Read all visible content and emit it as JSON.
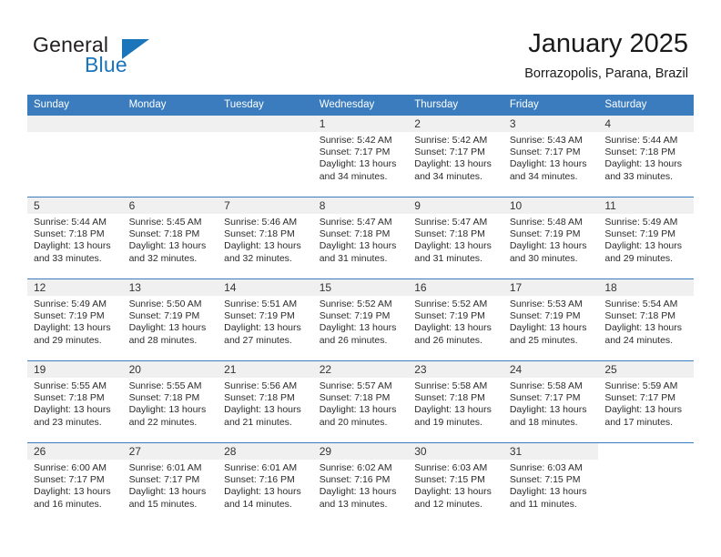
{
  "brand": {
    "word_general": "General",
    "word_blue": "Blue",
    "accent_color": "#1b75bb"
  },
  "header": {
    "title": "January 2025",
    "subtitle": "Borrazopolis, Parana, Brazil",
    "header_bg": "#3a7cbe",
    "daynum_bg": "#f0f0f0"
  },
  "weekdays": [
    "Sunday",
    "Monday",
    "Tuesday",
    "Wednesday",
    "Thursday",
    "Friday",
    "Saturday"
  ],
  "labels": {
    "sunrise_prefix": "Sunrise:",
    "sunset_prefix": "Sunset:",
    "daylight_prefix": "Daylight:"
  },
  "weeks": [
    [
      {
        "day": "",
        "empty": true
      },
      {
        "day": "",
        "empty": true
      },
      {
        "day": "",
        "empty": true
      },
      {
        "day": "1",
        "sunrise": "Sunrise: 5:42 AM",
        "sunset": "Sunset: 7:17 PM",
        "daylight_1": "Daylight: 13 hours",
        "daylight_2": "and 34 minutes."
      },
      {
        "day": "2",
        "sunrise": "Sunrise: 5:42 AM",
        "sunset": "Sunset: 7:17 PM",
        "daylight_1": "Daylight: 13 hours",
        "daylight_2": "and 34 minutes."
      },
      {
        "day": "3",
        "sunrise": "Sunrise: 5:43 AM",
        "sunset": "Sunset: 7:17 PM",
        "daylight_1": "Daylight: 13 hours",
        "daylight_2": "and 34 minutes."
      },
      {
        "day": "4",
        "sunrise": "Sunrise: 5:44 AM",
        "sunset": "Sunset: 7:18 PM",
        "daylight_1": "Daylight: 13 hours",
        "daylight_2": "and 33 minutes."
      }
    ],
    [
      {
        "day": "5",
        "sunrise": "Sunrise: 5:44 AM",
        "sunset": "Sunset: 7:18 PM",
        "daylight_1": "Daylight: 13 hours",
        "daylight_2": "and 33 minutes."
      },
      {
        "day": "6",
        "sunrise": "Sunrise: 5:45 AM",
        "sunset": "Sunset: 7:18 PM",
        "daylight_1": "Daylight: 13 hours",
        "daylight_2": "and 32 minutes."
      },
      {
        "day": "7",
        "sunrise": "Sunrise: 5:46 AM",
        "sunset": "Sunset: 7:18 PM",
        "daylight_1": "Daylight: 13 hours",
        "daylight_2": "and 32 minutes."
      },
      {
        "day": "8",
        "sunrise": "Sunrise: 5:47 AM",
        "sunset": "Sunset: 7:18 PM",
        "daylight_1": "Daylight: 13 hours",
        "daylight_2": "and 31 minutes."
      },
      {
        "day": "9",
        "sunrise": "Sunrise: 5:47 AM",
        "sunset": "Sunset: 7:18 PM",
        "daylight_1": "Daylight: 13 hours",
        "daylight_2": "and 31 minutes."
      },
      {
        "day": "10",
        "sunrise": "Sunrise: 5:48 AM",
        "sunset": "Sunset: 7:19 PM",
        "daylight_1": "Daylight: 13 hours",
        "daylight_2": "and 30 minutes."
      },
      {
        "day": "11",
        "sunrise": "Sunrise: 5:49 AM",
        "sunset": "Sunset: 7:19 PM",
        "daylight_1": "Daylight: 13 hours",
        "daylight_2": "and 29 minutes."
      }
    ],
    [
      {
        "day": "12",
        "sunrise": "Sunrise: 5:49 AM",
        "sunset": "Sunset: 7:19 PM",
        "daylight_1": "Daylight: 13 hours",
        "daylight_2": "and 29 minutes."
      },
      {
        "day": "13",
        "sunrise": "Sunrise: 5:50 AM",
        "sunset": "Sunset: 7:19 PM",
        "daylight_1": "Daylight: 13 hours",
        "daylight_2": "and 28 minutes."
      },
      {
        "day": "14",
        "sunrise": "Sunrise: 5:51 AM",
        "sunset": "Sunset: 7:19 PM",
        "daylight_1": "Daylight: 13 hours",
        "daylight_2": "and 27 minutes."
      },
      {
        "day": "15",
        "sunrise": "Sunrise: 5:52 AM",
        "sunset": "Sunset: 7:19 PM",
        "daylight_1": "Daylight: 13 hours",
        "daylight_2": "and 26 minutes."
      },
      {
        "day": "16",
        "sunrise": "Sunrise: 5:52 AM",
        "sunset": "Sunset: 7:19 PM",
        "daylight_1": "Daylight: 13 hours",
        "daylight_2": "and 26 minutes."
      },
      {
        "day": "17",
        "sunrise": "Sunrise: 5:53 AM",
        "sunset": "Sunset: 7:19 PM",
        "daylight_1": "Daylight: 13 hours",
        "daylight_2": "and 25 minutes."
      },
      {
        "day": "18",
        "sunrise": "Sunrise: 5:54 AM",
        "sunset": "Sunset: 7:18 PM",
        "daylight_1": "Daylight: 13 hours",
        "daylight_2": "and 24 minutes."
      }
    ],
    [
      {
        "day": "19",
        "sunrise": "Sunrise: 5:55 AM",
        "sunset": "Sunset: 7:18 PM",
        "daylight_1": "Daylight: 13 hours",
        "daylight_2": "and 23 minutes."
      },
      {
        "day": "20",
        "sunrise": "Sunrise: 5:55 AM",
        "sunset": "Sunset: 7:18 PM",
        "daylight_1": "Daylight: 13 hours",
        "daylight_2": "and 22 minutes."
      },
      {
        "day": "21",
        "sunrise": "Sunrise: 5:56 AM",
        "sunset": "Sunset: 7:18 PM",
        "daylight_1": "Daylight: 13 hours",
        "daylight_2": "and 21 minutes."
      },
      {
        "day": "22",
        "sunrise": "Sunrise: 5:57 AM",
        "sunset": "Sunset: 7:18 PM",
        "daylight_1": "Daylight: 13 hours",
        "daylight_2": "and 20 minutes."
      },
      {
        "day": "23",
        "sunrise": "Sunrise: 5:58 AM",
        "sunset": "Sunset: 7:18 PM",
        "daylight_1": "Daylight: 13 hours",
        "daylight_2": "and 19 minutes."
      },
      {
        "day": "24",
        "sunrise": "Sunrise: 5:58 AM",
        "sunset": "Sunset: 7:17 PM",
        "daylight_1": "Daylight: 13 hours",
        "daylight_2": "and 18 minutes."
      },
      {
        "day": "25",
        "sunrise": "Sunrise: 5:59 AM",
        "sunset": "Sunset: 7:17 PM",
        "daylight_1": "Daylight: 13 hours",
        "daylight_2": "and 17 minutes."
      }
    ],
    [
      {
        "day": "26",
        "sunrise": "Sunrise: 6:00 AM",
        "sunset": "Sunset: 7:17 PM",
        "daylight_1": "Daylight: 13 hours",
        "daylight_2": "and 16 minutes."
      },
      {
        "day": "27",
        "sunrise": "Sunrise: 6:01 AM",
        "sunset": "Sunset: 7:17 PM",
        "daylight_1": "Daylight: 13 hours",
        "daylight_2": "and 15 minutes."
      },
      {
        "day": "28",
        "sunrise": "Sunrise: 6:01 AM",
        "sunset": "Sunset: 7:16 PM",
        "daylight_1": "Daylight: 13 hours",
        "daylight_2": "and 14 minutes."
      },
      {
        "day": "29",
        "sunrise": "Sunrise: 6:02 AM",
        "sunset": "Sunset: 7:16 PM",
        "daylight_1": "Daylight: 13 hours",
        "daylight_2": "and 13 minutes."
      },
      {
        "day": "30",
        "sunrise": "Sunrise: 6:03 AM",
        "sunset": "Sunset: 7:15 PM",
        "daylight_1": "Daylight: 13 hours",
        "daylight_2": "and 12 minutes."
      },
      {
        "day": "31",
        "sunrise": "Sunrise: 6:03 AM",
        "sunset": "Sunset: 7:15 PM",
        "daylight_1": "Daylight: 13 hours",
        "daylight_2": "and 11 minutes."
      },
      {
        "day": "",
        "empty": true,
        "blank": true
      }
    ]
  ]
}
